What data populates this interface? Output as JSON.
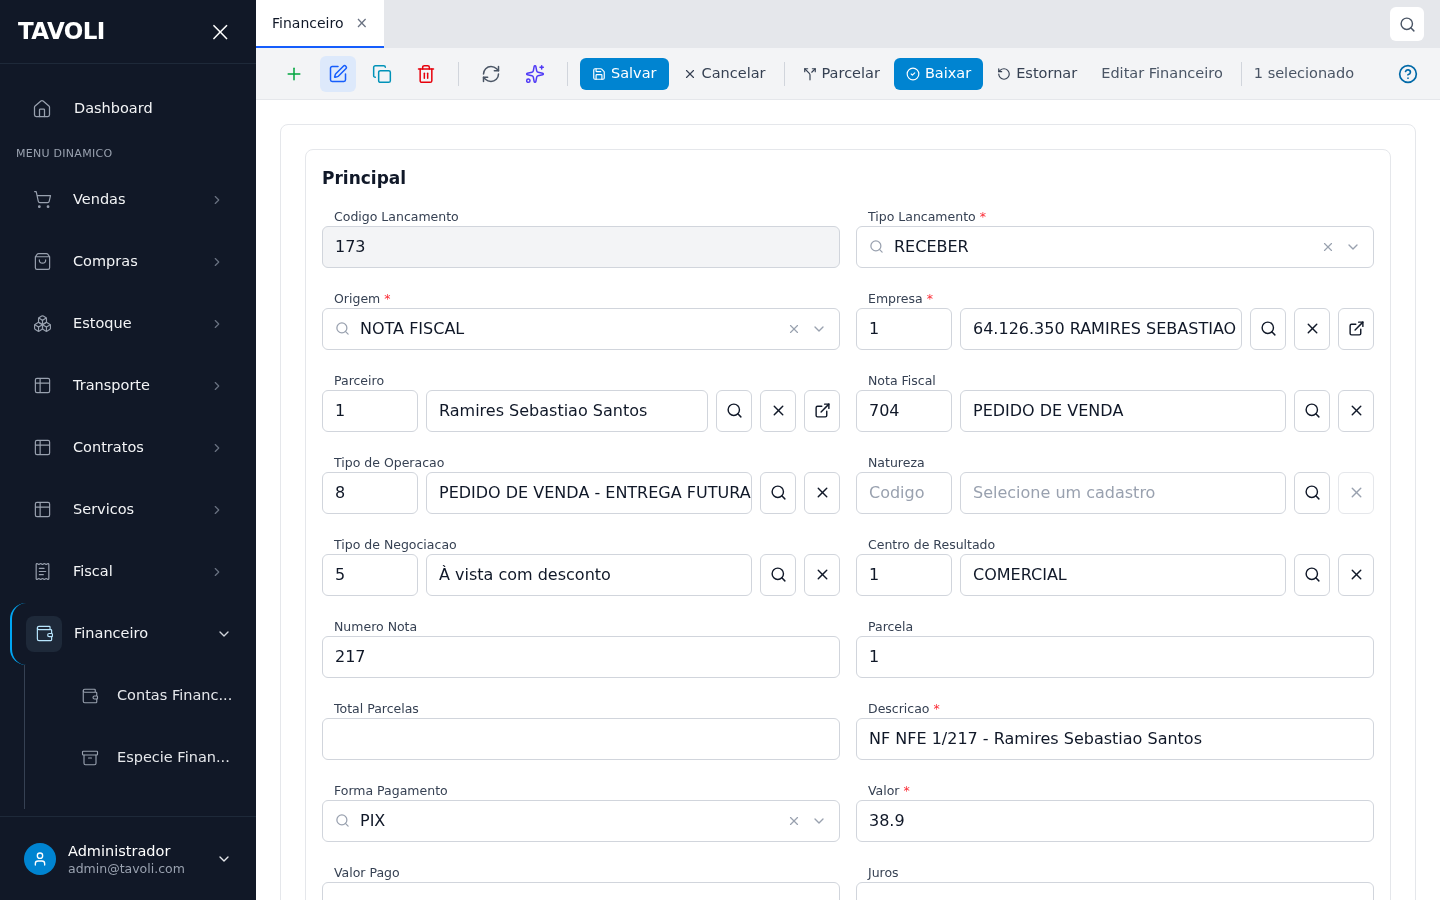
{
  "sidebar": {
    "logo": "TAVOLI",
    "close": "×",
    "top_items": [
      {
        "label": "Dashboard",
        "selected": false
      }
    ],
    "section": "MENU DINAMICO",
    "items": [
      {
        "label": "Vendas",
        "expanded": false,
        "selected": false
      },
      {
        "label": "Compras",
        "expanded": false,
        "selected": false
      },
      {
        "label": "Estoque",
        "expanded": false,
        "selected": false
      },
      {
        "label": "Transporte",
        "expanded": false,
        "selected": false
      },
      {
        "label": "Contratos",
        "expanded": false,
        "selected": false
      },
      {
        "label": "Servicos",
        "expanded": false,
        "selected": false
      },
      {
        "label": "Fiscal",
        "expanded": false,
        "selected": false
      },
      {
        "label": "Financeiro",
        "expanded": true,
        "selected": true,
        "children": [
          {
            "label": "Contas Financ...",
            "selected": false
          },
          {
            "label": "Especie Finan...",
            "selected": false
          }
        ]
      }
    ],
    "user": {
      "name": "Administrador",
      "email": "admin@tavoli.com"
    }
  },
  "tabs": [
    {
      "label": "Financeiro",
      "selected": true,
      "close": "×"
    }
  ],
  "toolbar": {
    "icon_buttons": [
      {
        "selected": false
      },
      {
        "selected": true
      },
      {
        "selected": false
      },
      {
        "selected": false
      },
      {
        "selected": false
      },
      {
        "selected": false
      }
    ],
    "actions": [
      {
        "label": "Salvar",
        "kind": "primary"
      },
      {
        "label": "Cancelar",
        "kind": "text"
      },
      {
        "label": "Parcelar",
        "kind": "text"
      },
      {
        "label": "Baixar",
        "kind": "primary"
      },
      {
        "label": "Estornar",
        "kind": "text"
      },
      {
        "label": "Editar Financeiro",
        "kind": "plain"
      }
    ],
    "selection": "1 selecionado"
  },
  "section": {
    "title": "Principal",
    "fields": [
      {
        "kind": "text",
        "label": "Codigo Lancamento",
        "value": "173",
        "disabled": true
      },
      {
        "kind": "select",
        "label": "Tipo Lancamento",
        "required_mark": "*",
        "value": "RECEBER"
      },
      {
        "kind": "select",
        "label": "Origem",
        "required_mark": "*",
        "value": "NOTA FISCAL"
      },
      {
        "kind": "lookup",
        "label": "Empresa",
        "required_mark": "*",
        "code": "1",
        "name": "64.126.350 RAMIRES SEBASTIAO",
        "buttons": [
          {
            "kind": "search",
            "disabled": false
          },
          {
            "kind": "clear",
            "disabled": false
          },
          {
            "kind": "open",
            "disabled": false
          }
        ]
      },
      {
        "kind": "lookup",
        "label": "Parceiro",
        "code": "1",
        "name": "Ramires Sebastiao Santos",
        "buttons": [
          {
            "kind": "search",
            "disabled": false
          },
          {
            "kind": "clear",
            "disabled": false
          },
          {
            "kind": "open",
            "disabled": false
          }
        ]
      },
      {
        "kind": "lookup",
        "label": "Nota Fiscal",
        "code": "704",
        "name": "PEDIDO DE VENDA",
        "buttons": [
          {
            "kind": "search",
            "disabled": false
          },
          {
            "kind": "clear",
            "disabled": false
          }
        ]
      },
      {
        "kind": "lookup",
        "label": "Tipo de Operacao",
        "code": "8",
        "name": "PEDIDO DE VENDA - ENTREGA FUTURA",
        "buttons": [
          {
            "kind": "search",
            "disabled": false
          },
          {
            "kind": "clear",
            "disabled": false
          }
        ]
      },
      {
        "kind": "lookup",
        "label": "Natureza",
        "code_placeholder": "Codigo",
        "name_placeholder": "Selecione um cadastro",
        "buttons": [
          {
            "kind": "search",
            "disabled": false
          },
          {
            "kind": "clear",
            "disabled": true
          }
        ]
      },
      {
        "kind": "lookup",
        "label": "Tipo de Negociacao",
        "code": "5",
        "name": "À vista com desconto",
        "buttons": [
          {
            "kind": "search",
            "disabled": false
          },
          {
            "kind": "clear",
            "disabled": false
          }
        ]
      },
      {
        "kind": "lookup",
        "label": "Centro de Resultado",
        "code": "1",
        "name": "COMERCIAL",
        "buttons": [
          {
            "kind": "search",
            "disabled": false
          },
          {
            "kind": "clear",
            "disabled": false
          }
        ]
      },
      {
        "kind": "text",
        "label": "Numero Nota",
        "value": "217",
        "disabled": false
      },
      {
        "kind": "text",
        "label": "Parcela",
        "value": "1",
        "disabled": false
      },
      {
        "kind": "text",
        "label": "Total Parcelas",
        "disabled": false
      },
      {
        "kind": "text",
        "label": "Descricao",
        "required_mark": "*",
        "value": "NF NFE 1/217 - Ramires Sebastiao Santos",
        "disabled": false
      },
      {
        "kind": "select",
        "label": "Forma Pagamento",
        "value": "PIX"
      },
      {
        "kind": "text",
        "label": "Valor",
        "required_mark": "*",
        "value": "38.9",
        "disabled": false
      },
      {
        "kind": "text",
        "label": "Valor Pago",
        "disabled": false
      },
      {
        "kind": "text",
        "label": "Juros",
        "disabled": false
      }
    ]
  }
}
